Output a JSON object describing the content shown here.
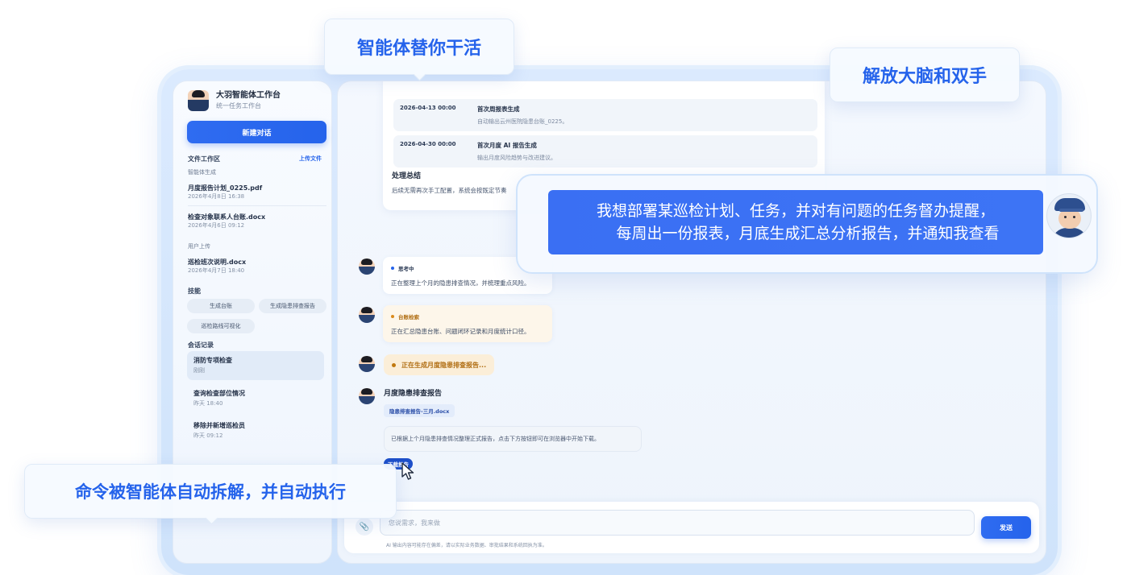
{
  "callouts": {
    "top": "智能体替你干活",
    "right": "解放大脑和双手",
    "bottom": "命令被智能体自动拆解，并自动执行"
  },
  "user_message": {
    "line1": "我想部署某巡检计划、任务，并对有问题的任务督办提醒，",
    "line2": "每周出一份报表，月底生成汇总分析报告，并通知我查看"
  },
  "sidebar": {
    "brand_title": "大羽智能体工作台",
    "brand_sub": "统一任务工作台",
    "new_chat": "新建对话",
    "files_head": "文件工作区",
    "upload_link": "上传文件",
    "generated_head": "智能体生成",
    "generated_files": [
      {
        "name": "月度报告计划_0225.pdf",
        "date": "2026年4月8日 16:38"
      },
      {
        "name": "检查对象联系人台账.docx",
        "date": "2026年4月6日 09:12"
      }
    ],
    "uploaded_head": "用户上传",
    "uploaded_files": [
      {
        "name": "巡检班次说明.docx",
        "date": "2026年4月7日 18:40"
      }
    ],
    "skills_head": "技能",
    "skills": [
      "生成台账",
      "生成隐患排查报告",
      "巡检路线可视化"
    ],
    "sessions_head": "会话记录",
    "sessions": [
      {
        "title": "消防专项检查",
        "time": "刚刚"
      },
      {
        "title": "查询检查部位情况",
        "time": "昨天 18:40"
      },
      {
        "title": "移除并新增巡检员",
        "time": "昨天 09:12"
      }
    ]
  },
  "chat": {
    "schedule": [
      {
        "date": "2026-04-13 00:00",
        "title": "首次周报表生成",
        "desc": "自动输出云州医院隐患台账_0225。"
      },
      {
        "date": "2026-04-30 00:00",
        "title": "首次月度 AI 报告生成",
        "desc": "输出月度风险趋势与改进建议。"
      }
    ],
    "summary_title": "处理总结",
    "summary_text": "后续无需再次手工配置，系统会按既定节奏",
    "thinking_tag": "思考中",
    "thinking_text": "正在整理上个月的隐患排查情况，并梳理重点风险。",
    "retrieval_tag": "台账检索",
    "retrieval_text": "正在汇总隐患台账、问题闭环记录和月度统计口径。",
    "generating": "正在生成月度隐患排查报告...",
    "report_title": "月度隐患排查报告",
    "report_file": "隐患排查报告-三月.docx",
    "report_msg": "已根据上个月隐患排查情况整理正式报告，点击下方按钮即可在浏览器中开始下载。",
    "download": "下载报告"
  },
  "input": {
    "placeholder": "您说需求，我来做",
    "send": "发送",
    "disclaimer": "AI 输出内容可能存在偏差，请以实际业务数据、审批结果和系统回执为准。"
  },
  "colors": {
    "accent": "#2563eb",
    "warning": "#b06d12",
    "frame": "#dbeafe"
  }
}
